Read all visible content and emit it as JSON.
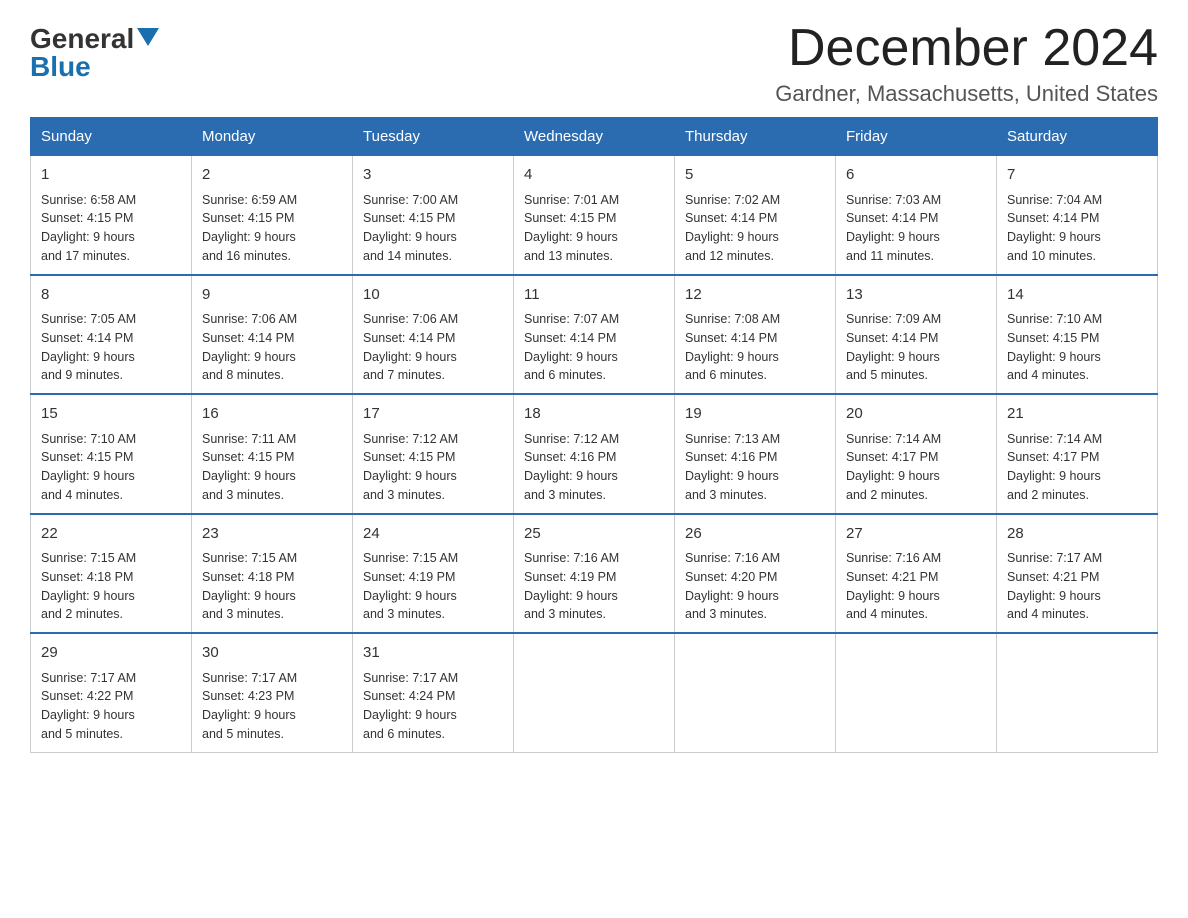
{
  "logo": {
    "general": "General",
    "blue": "Blue"
  },
  "title": "December 2024",
  "subtitle": "Gardner, Massachusetts, United States",
  "days_of_week": [
    "Sunday",
    "Monday",
    "Tuesday",
    "Wednesday",
    "Thursday",
    "Friday",
    "Saturday"
  ],
  "weeks": [
    [
      {
        "day": "1",
        "sunrise": "6:58 AM",
        "sunset": "4:15 PM",
        "daylight": "9 hours and 17 minutes."
      },
      {
        "day": "2",
        "sunrise": "6:59 AM",
        "sunset": "4:15 PM",
        "daylight": "9 hours and 16 minutes."
      },
      {
        "day": "3",
        "sunrise": "7:00 AM",
        "sunset": "4:15 PM",
        "daylight": "9 hours and 14 minutes."
      },
      {
        "day": "4",
        "sunrise": "7:01 AM",
        "sunset": "4:15 PM",
        "daylight": "9 hours and 13 minutes."
      },
      {
        "day": "5",
        "sunrise": "7:02 AM",
        "sunset": "4:14 PM",
        "daylight": "9 hours and 12 minutes."
      },
      {
        "day": "6",
        "sunrise": "7:03 AM",
        "sunset": "4:14 PM",
        "daylight": "9 hours and 11 minutes."
      },
      {
        "day": "7",
        "sunrise": "7:04 AM",
        "sunset": "4:14 PM",
        "daylight": "9 hours and 10 minutes."
      }
    ],
    [
      {
        "day": "8",
        "sunrise": "7:05 AM",
        "sunset": "4:14 PM",
        "daylight": "9 hours and 9 minutes."
      },
      {
        "day": "9",
        "sunrise": "7:06 AM",
        "sunset": "4:14 PM",
        "daylight": "9 hours and 8 minutes."
      },
      {
        "day": "10",
        "sunrise": "7:06 AM",
        "sunset": "4:14 PM",
        "daylight": "9 hours and 7 minutes."
      },
      {
        "day": "11",
        "sunrise": "7:07 AM",
        "sunset": "4:14 PM",
        "daylight": "9 hours and 6 minutes."
      },
      {
        "day": "12",
        "sunrise": "7:08 AM",
        "sunset": "4:14 PM",
        "daylight": "9 hours and 6 minutes."
      },
      {
        "day": "13",
        "sunrise": "7:09 AM",
        "sunset": "4:14 PM",
        "daylight": "9 hours and 5 minutes."
      },
      {
        "day": "14",
        "sunrise": "7:10 AM",
        "sunset": "4:15 PM",
        "daylight": "9 hours and 4 minutes."
      }
    ],
    [
      {
        "day": "15",
        "sunrise": "7:10 AM",
        "sunset": "4:15 PM",
        "daylight": "9 hours and 4 minutes."
      },
      {
        "day": "16",
        "sunrise": "7:11 AM",
        "sunset": "4:15 PM",
        "daylight": "9 hours and 3 minutes."
      },
      {
        "day": "17",
        "sunrise": "7:12 AM",
        "sunset": "4:15 PM",
        "daylight": "9 hours and 3 minutes."
      },
      {
        "day": "18",
        "sunrise": "7:12 AM",
        "sunset": "4:16 PM",
        "daylight": "9 hours and 3 minutes."
      },
      {
        "day": "19",
        "sunrise": "7:13 AM",
        "sunset": "4:16 PM",
        "daylight": "9 hours and 3 minutes."
      },
      {
        "day": "20",
        "sunrise": "7:14 AM",
        "sunset": "4:17 PM",
        "daylight": "9 hours and 2 minutes."
      },
      {
        "day": "21",
        "sunrise": "7:14 AM",
        "sunset": "4:17 PM",
        "daylight": "9 hours and 2 minutes."
      }
    ],
    [
      {
        "day": "22",
        "sunrise": "7:15 AM",
        "sunset": "4:18 PM",
        "daylight": "9 hours and 2 minutes."
      },
      {
        "day": "23",
        "sunrise": "7:15 AM",
        "sunset": "4:18 PM",
        "daylight": "9 hours and 3 minutes."
      },
      {
        "day": "24",
        "sunrise": "7:15 AM",
        "sunset": "4:19 PM",
        "daylight": "9 hours and 3 minutes."
      },
      {
        "day": "25",
        "sunrise": "7:16 AM",
        "sunset": "4:19 PM",
        "daylight": "9 hours and 3 minutes."
      },
      {
        "day": "26",
        "sunrise": "7:16 AM",
        "sunset": "4:20 PM",
        "daylight": "9 hours and 3 minutes."
      },
      {
        "day": "27",
        "sunrise": "7:16 AM",
        "sunset": "4:21 PM",
        "daylight": "9 hours and 4 minutes."
      },
      {
        "day": "28",
        "sunrise": "7:17 AM",
        "sunset": "4:21 PM",
        "daylight": "9 hours and 4 minutes."
      }
    ],
    [
      {
        "day": "29",
        "sunrise": "7:17 AM",
        "sunset": "4:22 PM",
        "daylight": "9 hours and 5 minutes."
      },
      {
        "day": "30",
        "sunrise": "7:17 AM",
        "sunset": "4:23 PM",
        "daylight": "9 hours and 5 minutes."
      },
      {
        "day": "31",
        "sunrise": "7:17 AM",
        "sunset": "4:24 PM",
        "daylight": "9 hours and 6 minutes."
      },
      null,
      null,
      null,
      null
    ]
  ],
  "labels": {
    "sunrise": "Sunrise:",
    "sunset": "Sunset:",
    "daylight": "Daylight:"
  }
}
